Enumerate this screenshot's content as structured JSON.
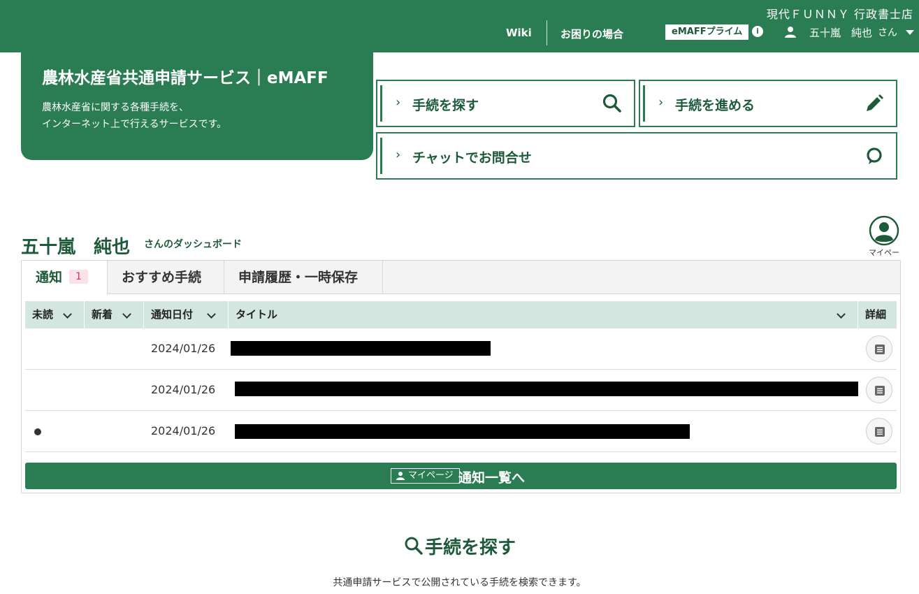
{
  "header": {
    "office_name": "現代ＦＵＮＮＹ 行政書士店",
    "nav_wiki": "Wiki",
    "nav_help": "お困りの場合",
    "prime_badge": "eMAFFプライム",
    "info_glyph": "i",
    "user_name": "五十嵐　純也",
    "user_suffix": "さん",
    "user_icon": "person-icon",
    "colors": {
      "brand": "#2a7d52",
      "brand_dark": "#1e5a3a"
    }
  },
  "hero": {
    "title": "農林水産省共通申請サービス｜eMAFF",
    "desc_line1": "農林水産省に関する各種手続を、",
    "desc_line2": "インターネット上で行えるサービスです。"
  },
  "actions": [
    {
      "chevron": "›",
      "label": "手続を探す",
      "icon": "search-icon"
    },
    {
      "chevron": "›",
      "label": "手続を進める",
      "icon": "pencil-icon"
    },
    {
      "chevron": "›",
      "label": "チャットでお問合せ",
      "icon": "chat-icon"
    }
  ],
  "dashboard": {
    "user_name": "五十嵐　純也",
    "suffix": "さんのダッシュボード",
    "mypage_label": "マイページ"
  },
  "tabs": [
    {
      "label": "通知",
      "badge": "1",
      "active": true
    },
    {
      "label": "おすすめ手続",
      "active": false
    },
    {
      "label": "申請履歴・一時保存",
      "active": false
    }
  ],
  "table": {
    "headers": {
      "unread": "未読",
      "new": "新着",
      "date": "通知日付",
      "title": "タイトル",
      "detail": "詳細"
    },
    "rows": [
      {
        "unread": false,
        "date": "2024/01/26"
      },
      {
        "unread": false,
        "date": "2024/01/26"
      },
      {
        "unread": true,
        "date": "2024/01/26"
      }
    ]
  },
  "list_button": {
    "badge": "マイページ",
    "label": "通知一覧へ"
  },
  "search_section": {
    "title": "手続を探す",
    "desc": "共通申請サービスで公開されている手続を検索できます。"
  }
}
